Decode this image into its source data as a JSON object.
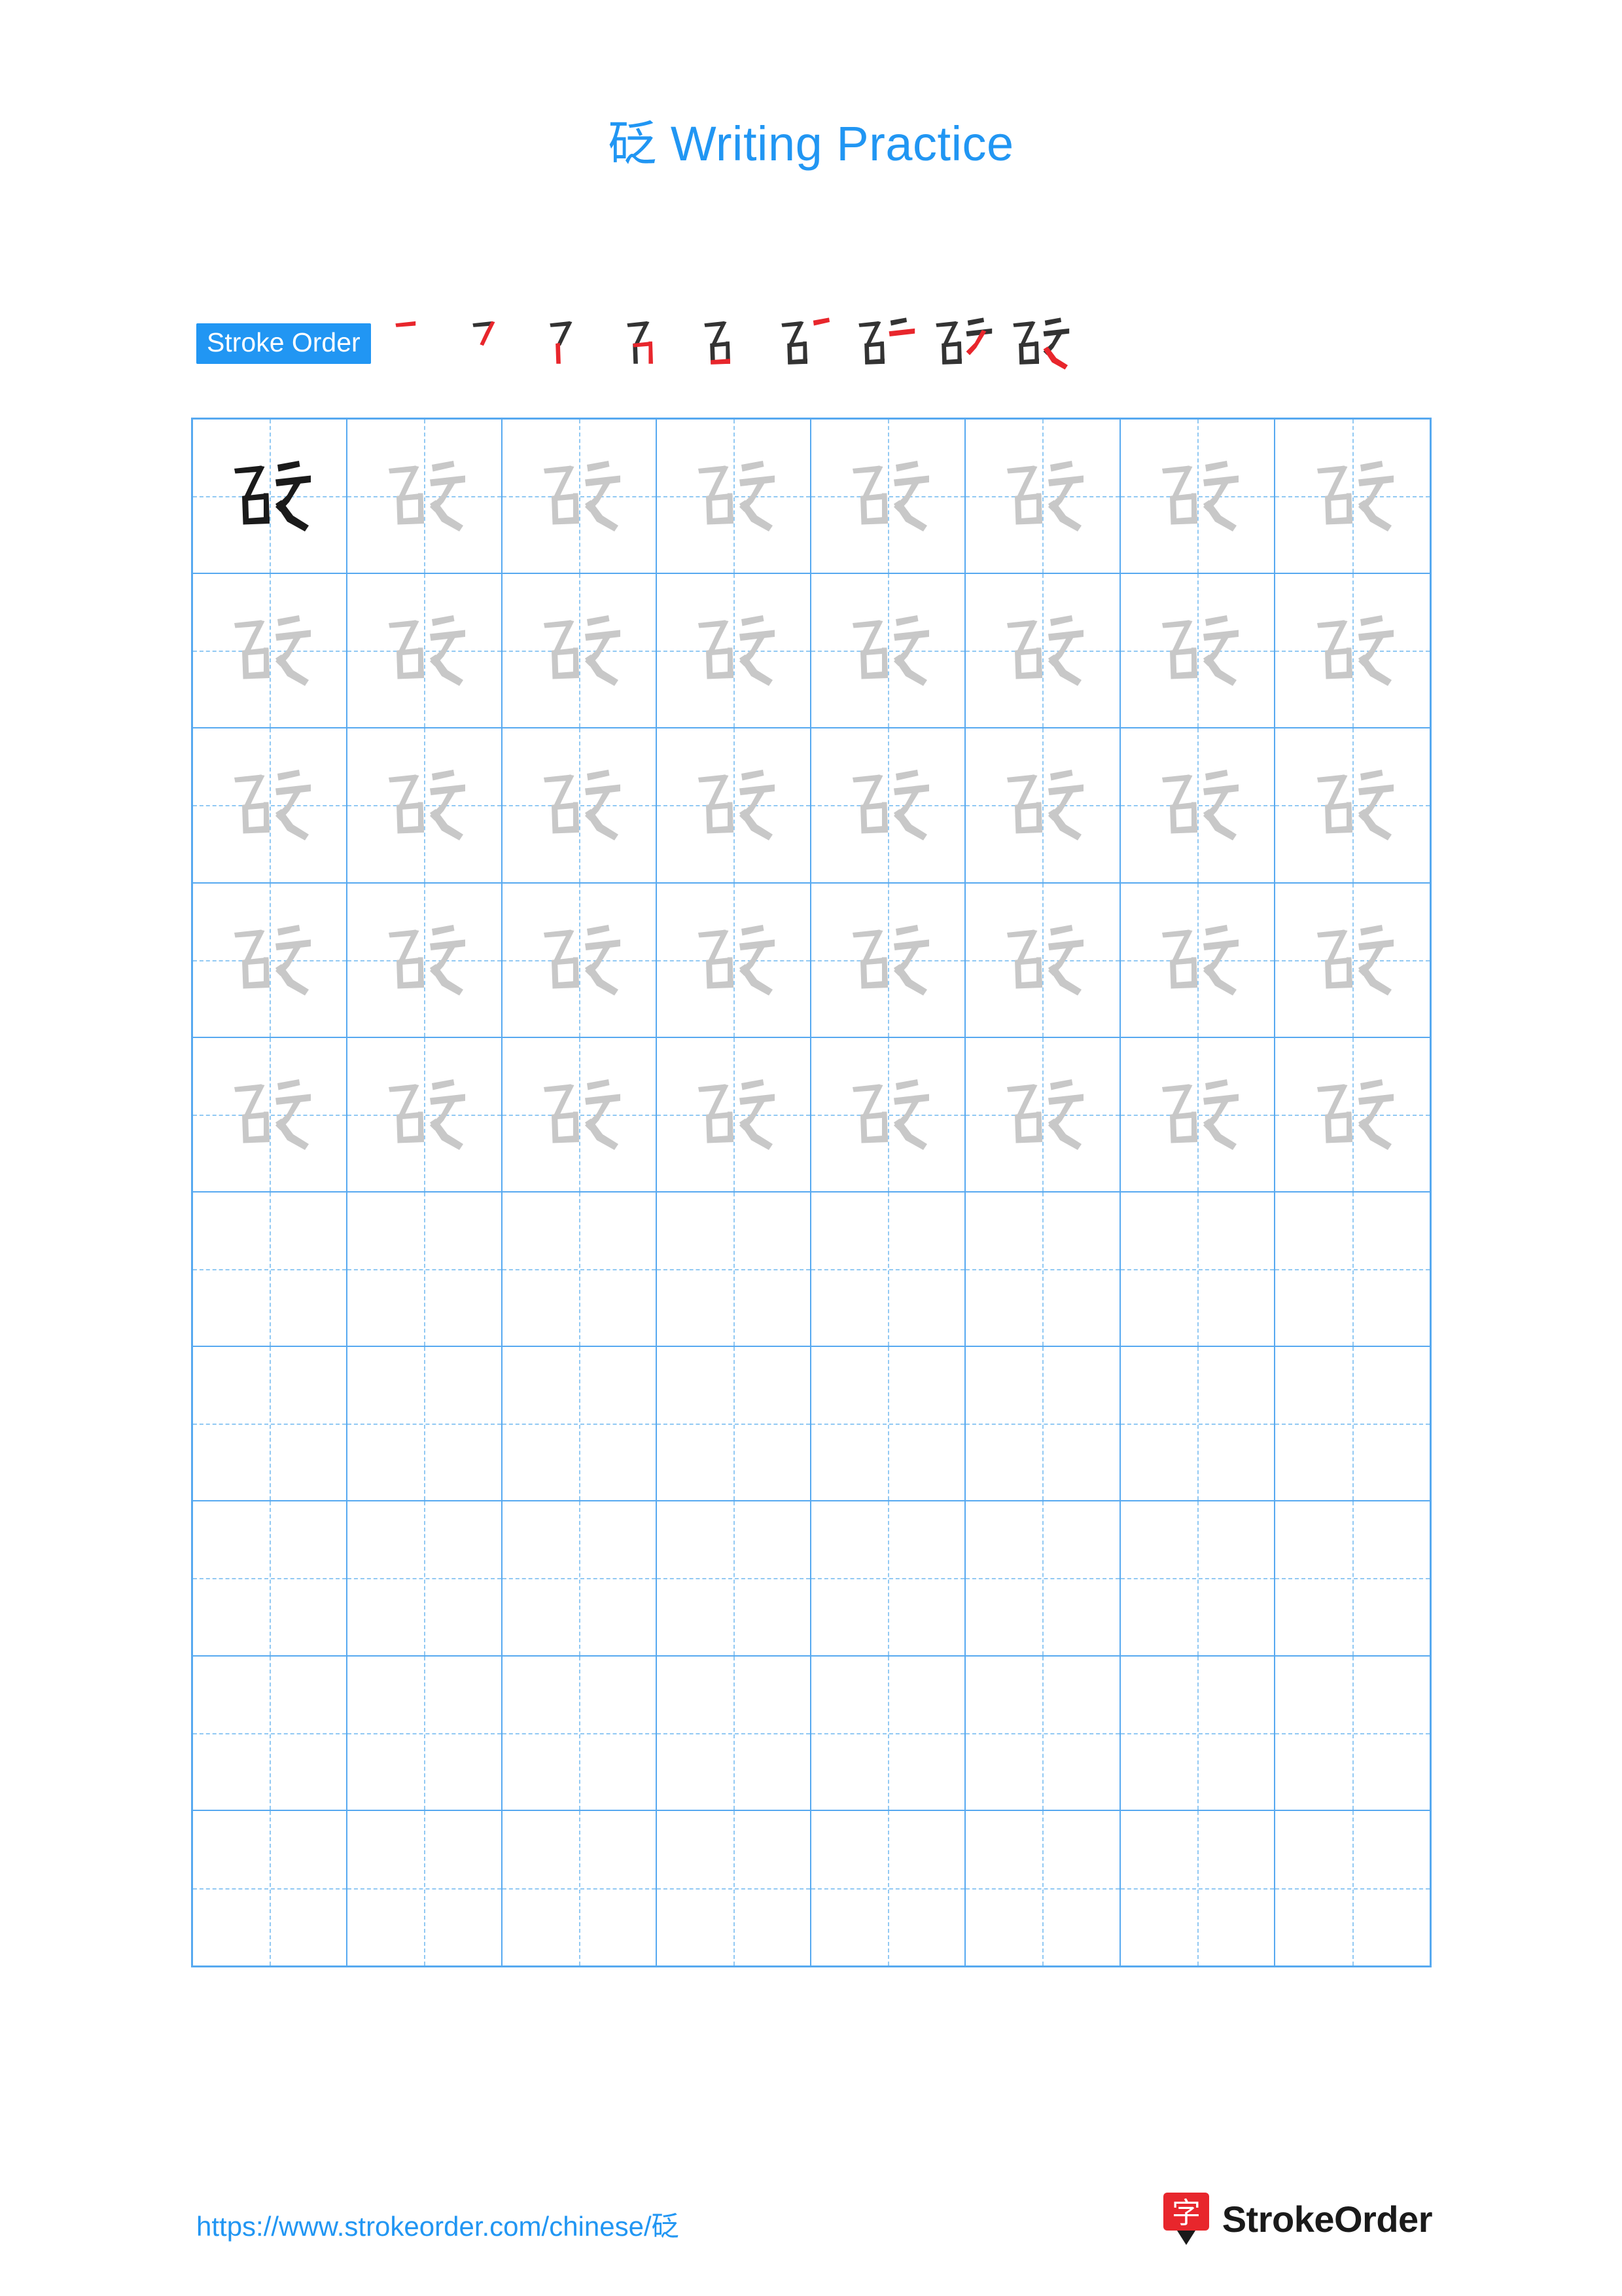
{
  "page": {
    "title_char": "砭",
    "title_suffix": " Writing Practice",
    "accent_color": "#2196f3",
    "grid_line_color": "#57a9f0",
    "guide_line_color": "#7fc0f2",
    "trace_glyph_color": "#c8c8c8",
    "solid_glyph_color": "#1a1a1a",
    "stroke_new_color": "#e8262c",
    "stroke_old_color": "#333333"
  },
  "stroke_order": {
    "label": "Stroke Order",
    "character": "砭",
    "total_strokes": 9,
    "steps": [
      {
        "index": 1,
        "partial": "丿"
      },
      {
        "index": 2,
        "partial": "丆"
      },
      {
        "index": 3,
        "partial": "厂丨"
      },
      {
        "index": 4,
        "partial": "石(4)"
      },
      {
        "index": 5,
        "partial": "石"
      },
      {
        "index": 6,
        "partial": "石丿"
      },
      {
        "index": 7,
        "partial": "石㇆"
      },
      {
        "index": 8,
        "partial": "砭(8)"
      },
      {
        "index": 9,
        "partial": "砭"
      }
    ]
  },
  "practice_grid": {
    "columns": 8,
    "rows": 10,
    "solid_cells": [
      {
        "row": 0,
        "col": 0
      }
    ],
    "traced_rows": 5,
    "empty_rows": 5,
    "character": "砭"
  },
  "footer": {
    "url": "https://www.strokeorder.com/chinese/砭",
    "brand_name": "StrokeOrder",
    "brand_logo_char": "字"
  }
}
